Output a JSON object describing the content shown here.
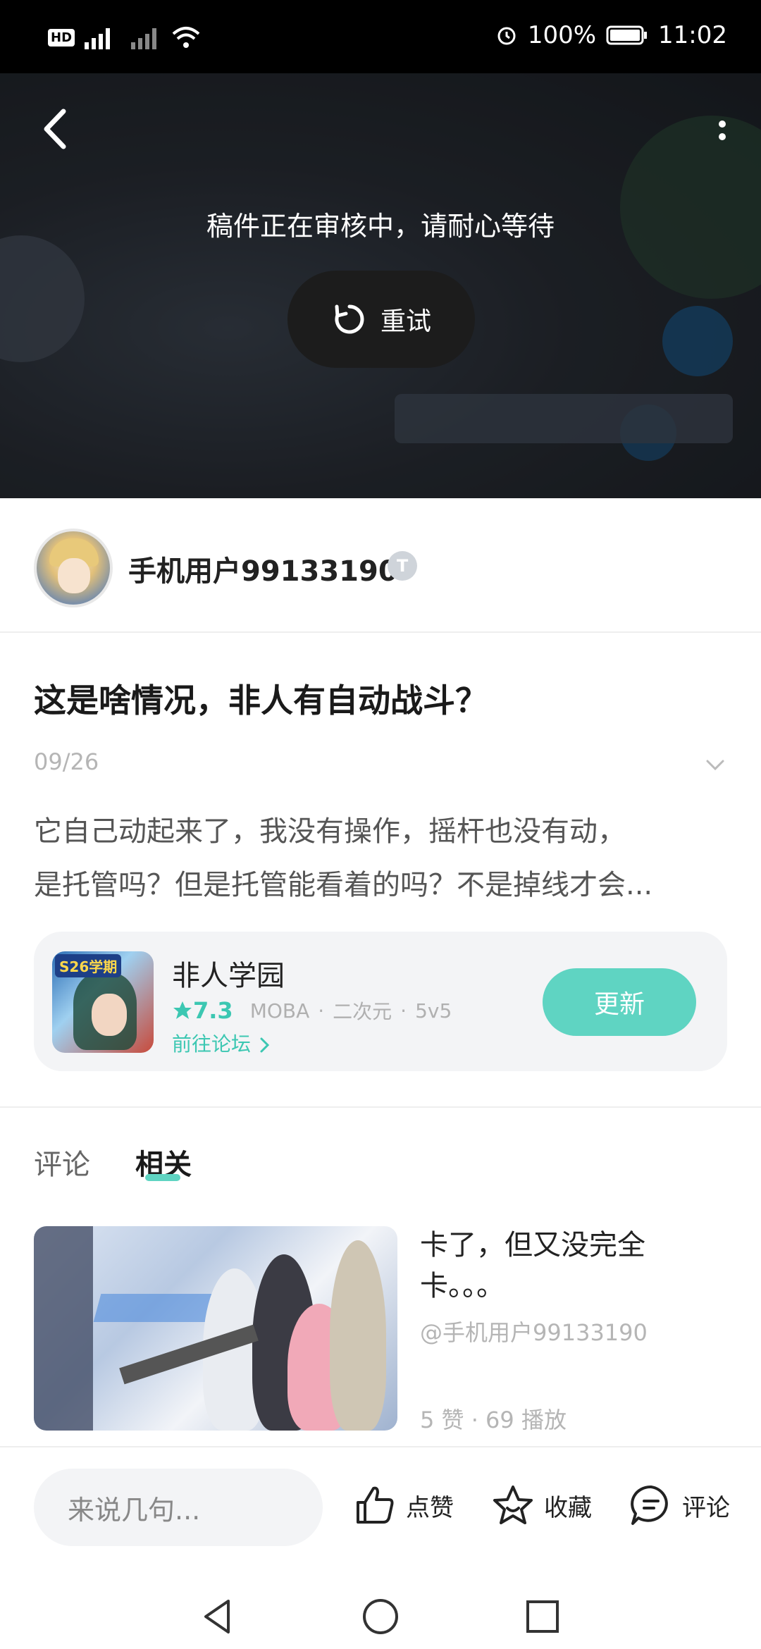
{
  "status_bar": {
    "network": "HD 5G 6",
    "battery": "100%",
    "time": "11:02"
  },
  "video": {
    "review_message": "稿件正在审核中，请耐心等待",
    "retry_label": "重试"
  },
  "author": {
    "name": "手机用户99133190",
    "level_badge": "T"
  },
  "post": {
    "title": "这是啥情况，非人有自动战斗？",
    "date": "09/26",
    "body_line1": "它自己动起来了，我没有操作，摇杆也没有动，",
    "body_line2": "是托管吗？但是托管能看着的吗？不是掉线才会..."
  },
  "game_card": {
    "icon_tag": "S26学期",
    "name": "非人学园",
    "score": "7.3",
    "tags": [
      "MOBA",
      "二次元",
      "5v5"
    ],
    "forum_link": "前往论坛",
    "update_label": "更新"
  },
  "tabs": {
    "comment": "评论",
    "related": "相关",
    "active": "related"
  },
  "related": [
    {
      "title": "卡了，但又没完全卡。。。",
      "author": "@手机用户99133190",
      "stats": "5 赞 · 69 播放"
    }
  ],
  "bottom_bar": {
    "comment_placeholder": "来说几句...",
    "like_label": "点赞",
    "favorite_label": "收藏",
    "comment_label": "评论"
  },
  "colors": {
    "accent": "#5fd4c2",
    "accent_text": "#3cc7b2"
  }
}
